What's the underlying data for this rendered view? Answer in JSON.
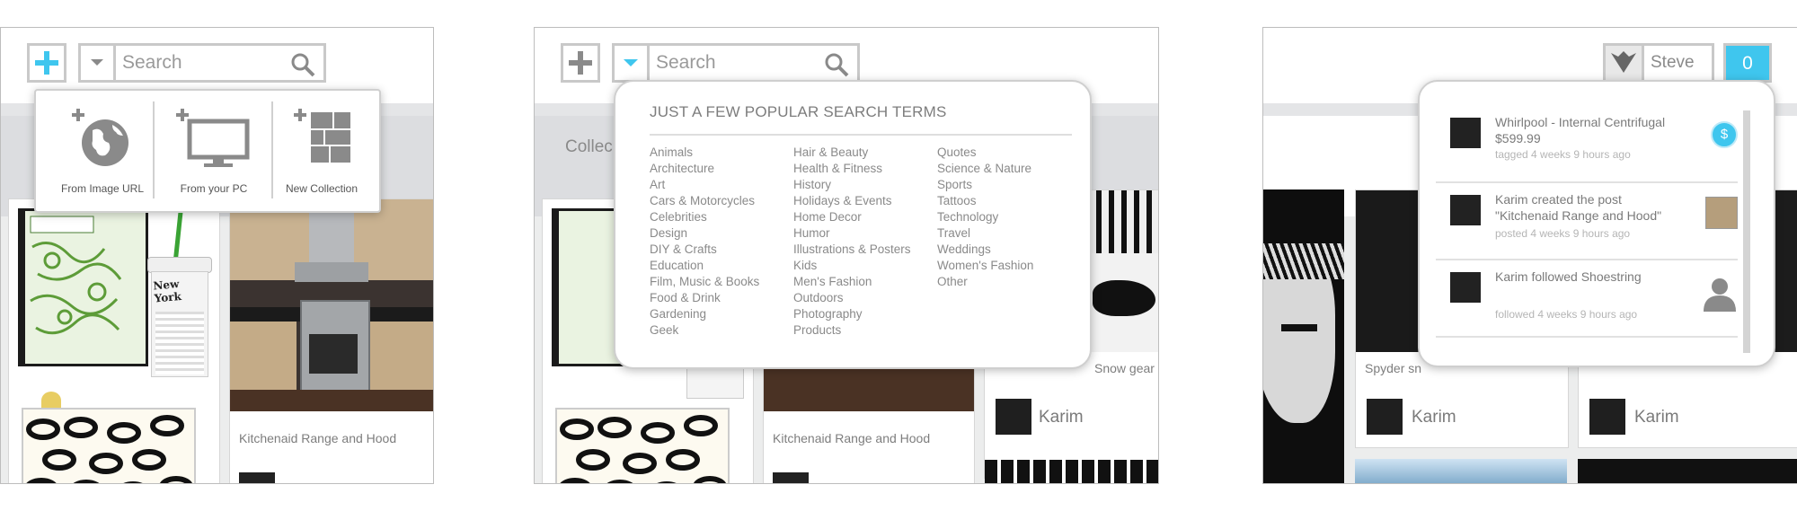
{
  "colors": {
    "accent": "#3fc6ee",
    "border": "#c9c9c9",
    "text": "#8a8a8a"
  },
  "search": {
    "placeholder": "Search"
  },
  "panel1": {
    "upload_options": [
      {
        "label": "From Image URL",
        "icon": "globe-icon"
      },
      {
        "label": "From your PC",
        "icon": "monitor-icon"
      },
      {
        "label": "New Collection",
        "icon": "grid-icon"
      }
    ],
    "card_title": "Kitchenaid Range and Hood"
  },
  "panel2": {
    "collections_partial": "Collec",
    "terms_title": "JUST A FEW POPULAR SEARCH TERMS",
    "terms_col1": [
      "Animals",
      "Architecture",
      "Art",
      "Cars & Motorcycles",
      "Celebrities",
      "Design",
      "DIY & Crafts",
      "Education",
      "Film, Music & Books",
      "Food & Drink",
      "Gardening",
      "Geek"
    ],
    "terms_col2": [
      "Hair & Beauty",
      "Health & Fitness",
      "History",
      "Holidays & Events",
      "Home Decor",
      "Humor",
      "Illustrations & Posters",
      "Kids",
      "Men's Fashion",
      "Outdoors",
      "Photography",
      "Products"
    ],
    "terms_col3": [
      "Quotes",
      "Science & Nature",
      "Sports",
      "Tattoos",
      "Technology",
      "Travel",
      "Weddings",
      "Women's Fashion",
      "Other"
    ],
    "card_title": "Kitchenaid Range and Hood",
    "side_card_title": "Snow gear",
    "user_name": "Karim"
  },
  "panel3": {
    "user_name": "Steve",
    "notification_count": "0",
    "notifications": [
      {
        "line1": "Whirlpool - Internal Centrifugal",
        "line2": "$599.99",
        "meta": "tagged 4 weeks 9 hours ago",
        "badge": "$"
      },
      {
        "line1": "Karim created the post",
        "line2": "\"Kitchenaid Range and Hood\"",
        "meta": "posted 4 weeks 9 hours ago"
      },
      {
        "line1": "Karim followed Shoestring",
        "line2": "",
        "meta": "followed 4 weeks 9 hours ago"
      }
    ],
    "card_partial": "Spyder sn",
    "karim_1": "Karim",
    "karim_2": "Karim"
  }
}
